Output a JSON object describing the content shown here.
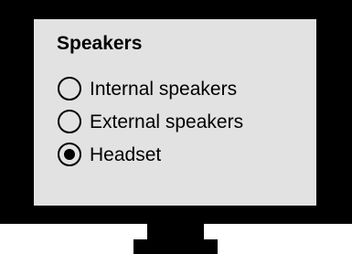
{
  "panel": {
    "title": "Speakers",
    "options": [
      {
        "label": "Internal speakers",
        "selected": false,
        "icon": "radio-unchecked-icon"
      },
      {
        "label": "External speakers",
        "selected": false,
        "icon": "radio-unchecked-icon"
      },
      {
        "label": "Headset",
        "selected": true,
        "icon": "radio-checked-icon"
      }
    ]
  },
  "colors": {
    "frame": "#000000",
    "screen": "#e2e2e2",
    "text": "#000000"
  }
}
